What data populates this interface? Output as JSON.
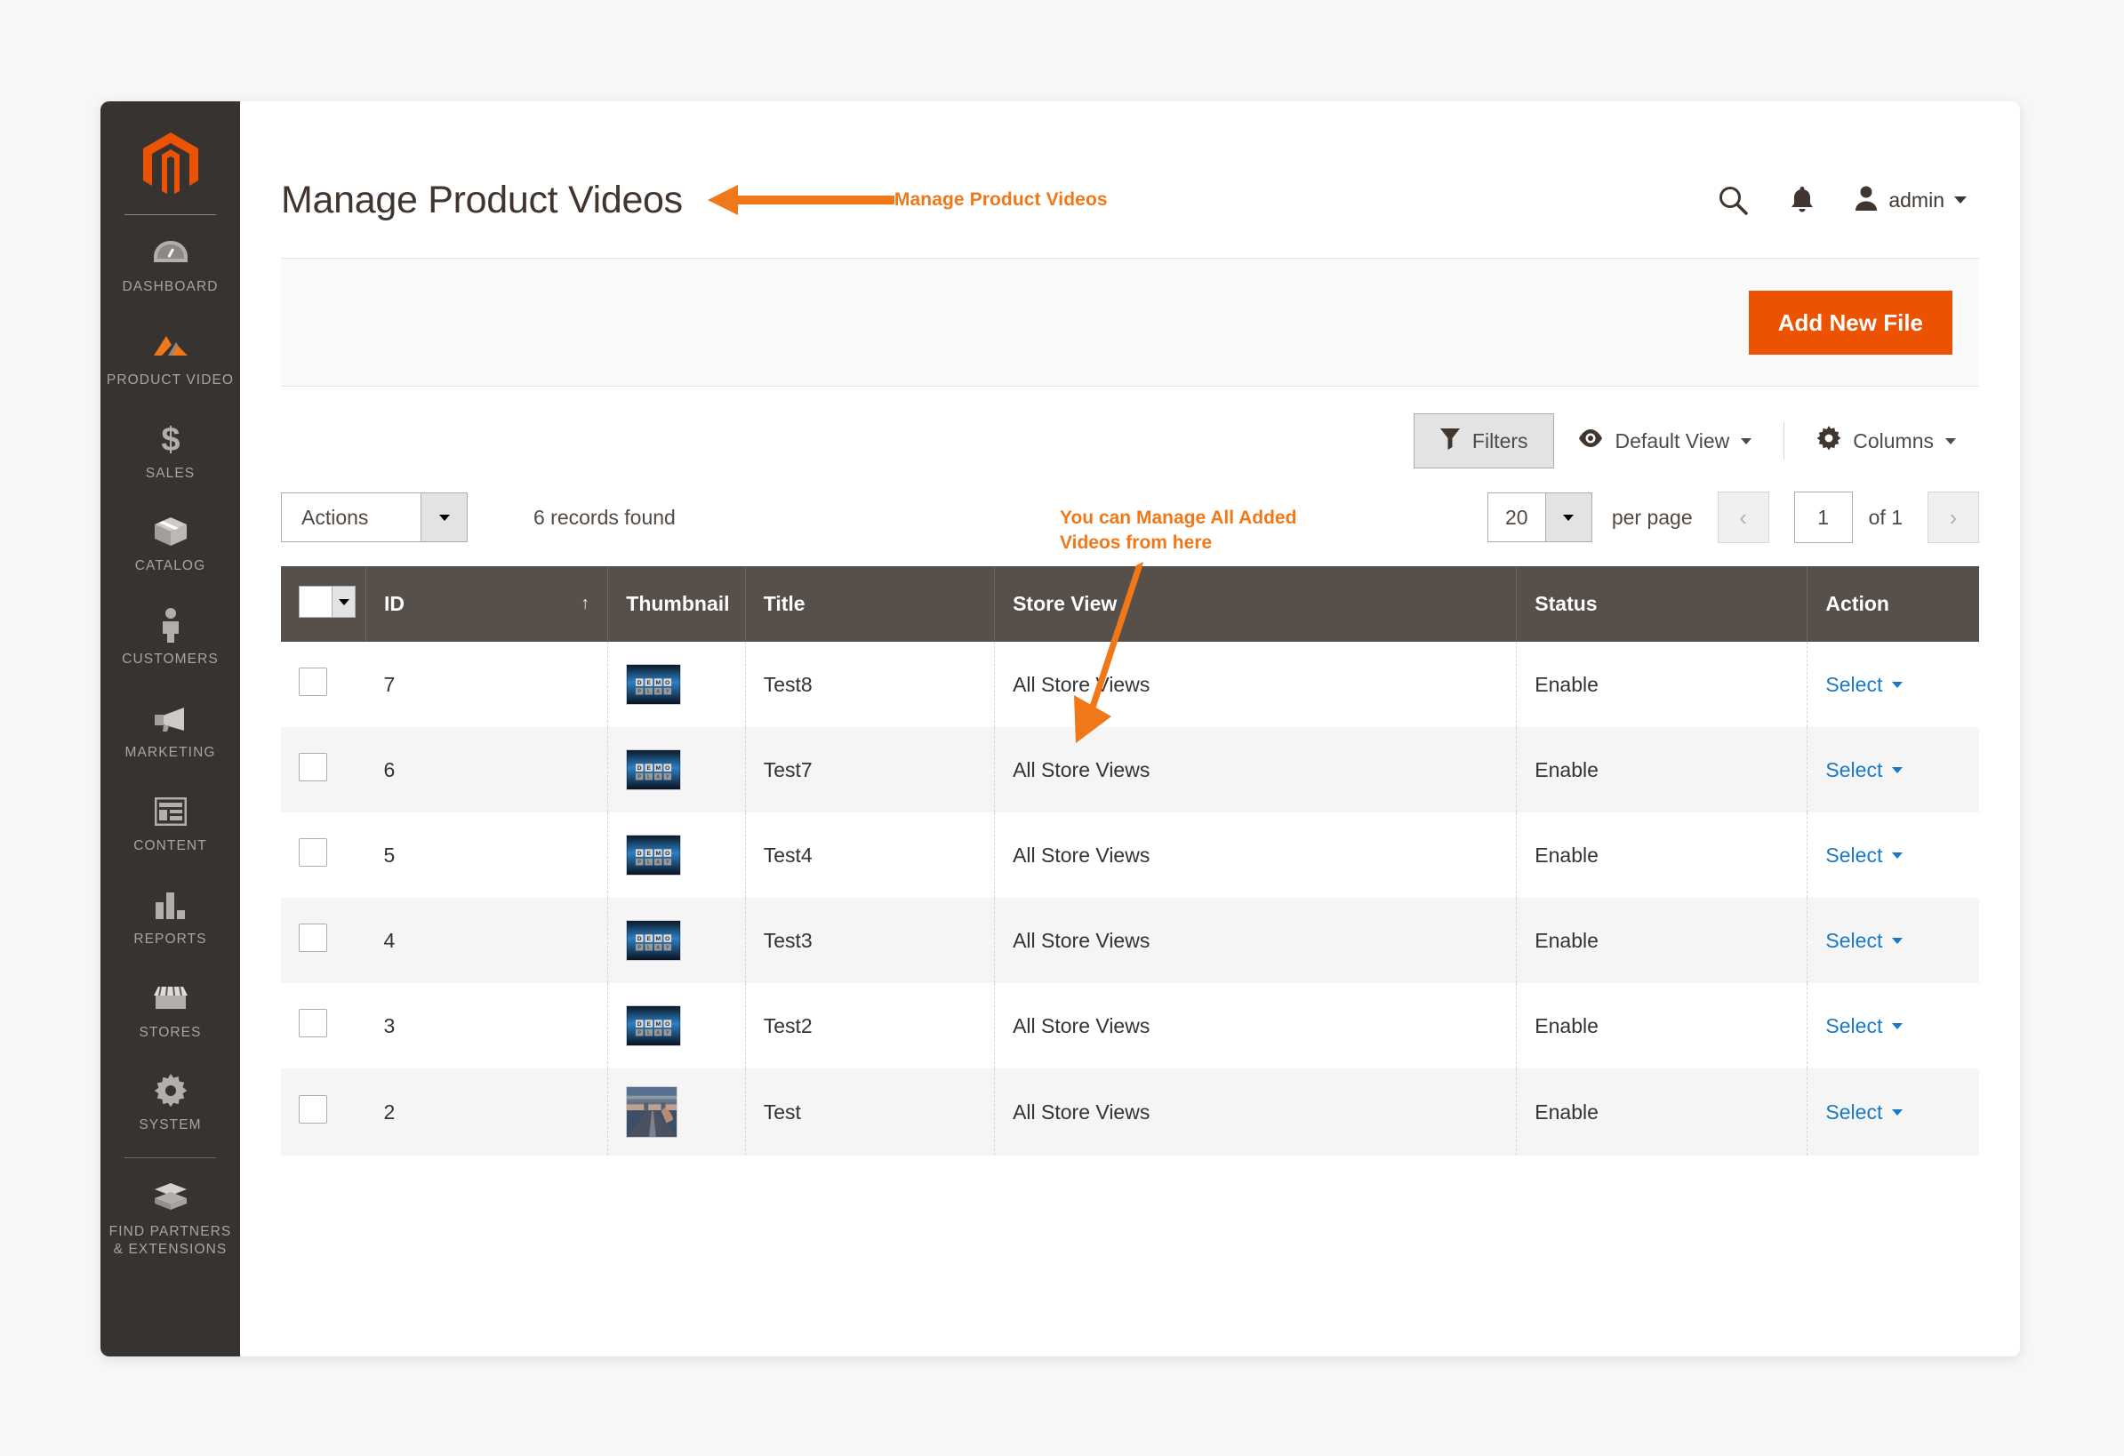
{
  "colors": {
    "brand_orange": "#eb5202",
    "annotation_orange": "#f07818",
    "sidebar_bg": "#373330",
    "table_header_bg": "#564f4a",
    "link_blue": "#1979c3"
  },
  "sidebar": {
    "logo": "magento-logo",
    "items": [
      {
        "label": "DASHBOARD",
        "icon": "dashboard-gauge-icon",
        "active": false
      },
      {
        "label": "PRODUCT VIDEO",
        "icon": "product-video-icon",
        "active": true
      },
      {
        "label": "SALES",
        "icon": "dollar-sign-icon",
        "active": false
      },
      {
        "label": "CATALOG",
        "icon": "box-icon",
        "active": false
      },
      {
        "label": "CUSTOMERS",
        "icon": "person-icon",
        "active": false
      },
      {
        "label": "MARKETING",
        "icon": "megaphone-icon",
        "active": false
      },
      {
        "label": "CONTENT",
        "icon": "layout-page-icon",
        "active": false
      },
      {
        "label": "REPORTS",
        "icon": "bar-chart-icon",
        "active": false
      },
      {
        "label": "STORES",
        "icon": "storefront-icon",
        "active": false
      },
      {
        "label": "SYSTEM",
        "icon": "gear-icon",
        "active": false
      }
    ],
    "footer_item": {
      "label": "FIND PARTNERS & EXTENSIONS",
      "icon": "stacked-boxes-icon"
    }
  },
  "header": {
    "title": "Manage Product Videos",
    "annotation": "Manage Product Videos",
    "search_icon": "search-icon",
    "notifications_icon": "bell-icon",
    "user_icon": "user-avatar-icon",
    "username": "admin"
  },
  "toolbar": {
    "add_new_file_label": "Add New File"
  },
  "annotations": {
    "grid_note_line1": "You can Manage All Added",
    "grid_note_line2": "Videos from here"
  },
  "grid_controls": {
    "filters_label": "Filters",
    "filters_icon": "funnel-icon",
    "view_icon": "eye-icon",
    "view_label": "Default View",
    "columns_icon": "gear-icon",
    "columns_label": "Columns",
    "actions_label": "Actions",
    "records_found": "6 records found",
    "per_page_value": "20",
    "per_page_label": "per page",
    "prev_icon": "chevron-left-icon",
    "next_icon": "chevron-right-icon",
    "current_page": "1",
    "of_pages": "of 1"
  },
  "table": {
    "columns": [
      {
        "key": "check",
        "label": ""
      },
      {
        "key": "id",
        "label": "ID",
        "sort": "↑"
      },
      {
        "key": "thumbnail",
        "label": "Thumbnail"
      },
      {
        "key": "title",
        "label": "Title"
      },
      {
        "key": "store",
        "label": "Store View"
      },
      {
        "key": "status",
        "label": "Status"
      },
      {
        "key": "action",
        "label": "Action"
      }
    ],
    "action_label": "Select",
    "rows": [
      {
        "id": "7",
        "thumbnail": "demo-video-thumbnail",
        "title": "Test8",
        "store": "All Store Views",
        "status": "Enable",
        "action": "Select"
      },
      {
        "id": "6",
        "thumbnail": "demo-video-thumbnail",
        "title": "Test7",
        "store": "All Store Views",
        "status": "Enable",
        "action": "Select"
      },
      {
        "id": "5",
        "thumbnail": "demo-video-thumbnail",
        "title": "Test4",
        "store": "All Store Views",
        "status": "Enable",
        "action": "Select"
      },
      {
        "id": "4",
        "thumbnail": "demo-video-thumbnail",
        "title": "Test3",
        "store": "All Store Views",
        "status": "Enable",
        "action": "Select"
      },
      {
        "id": "3",
        "thumbnail": "demo-video-thumbnail",
        "title": "Test2",
        "store": "All Store Views",
        "status": "Enable",
        "action": "Select"
      },
      {
        "id": "2",
        "thumbnail": "road-overpass-photo-thumbnail",
        "title": "Test",
        "store": "All Store Views",
        "status": "Enable",
        "action": "Select"
      }
    ]
  }
}
